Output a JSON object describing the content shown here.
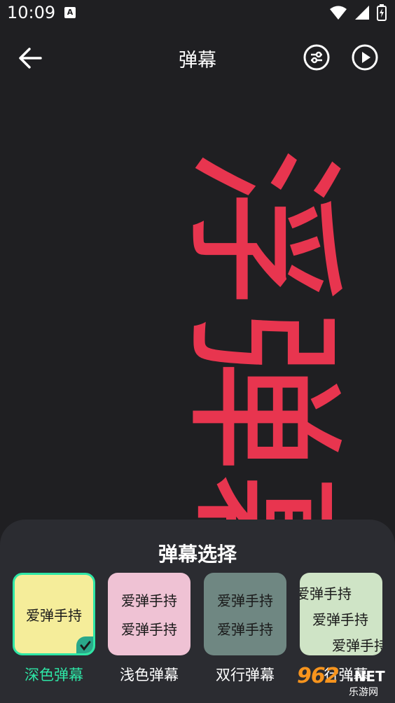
{
  "status_bar": {
    "time": "10:09",
    "notification_icon": "A"
  },
  "header": {
    "title": "弹幕",
    "back_icon": "arrow-left-icon",
    "settings_icon": "sliders-icon",
    "play_icon": "play-icon"
  },
  "preview": {
    "text": "浮弹幕",
    "color": "#e8354f"
  },
  "panel": {
    "title": "弹幕选择",
    "styles": [
      {
        "label": "深色弹幕",
        "card_lines": [
          "爱弹手持"
        ],
        "bg": "#f5ed9a",
        "selected": true
      },
      {
        "label": "浅色弹幕",
        "card_lines": [
          "爱弹手持",
          "爱弹手持"
        ],
        "bg": "#efc2d4",
        "selected": false
      },
      {
        "label": "双行弹幕",
        "card_lines": [
          "爱弹手持",
          "爱弹手持"
        ],
        "bg": "#6f8782",
        "selected": false
      },
      {
        "label": "行弹幕",
        "card_lines": [
          "爱弹手持",
          "爱弹手持",
          "爱弹手持"
        ],
        "bg": "#cfe4c6",
        "selected": false
      }
    ]
  },
  "watermark": {
    "logo": "962",
    "net": ".NET",
    "sub": "乐游网"
  }
}
